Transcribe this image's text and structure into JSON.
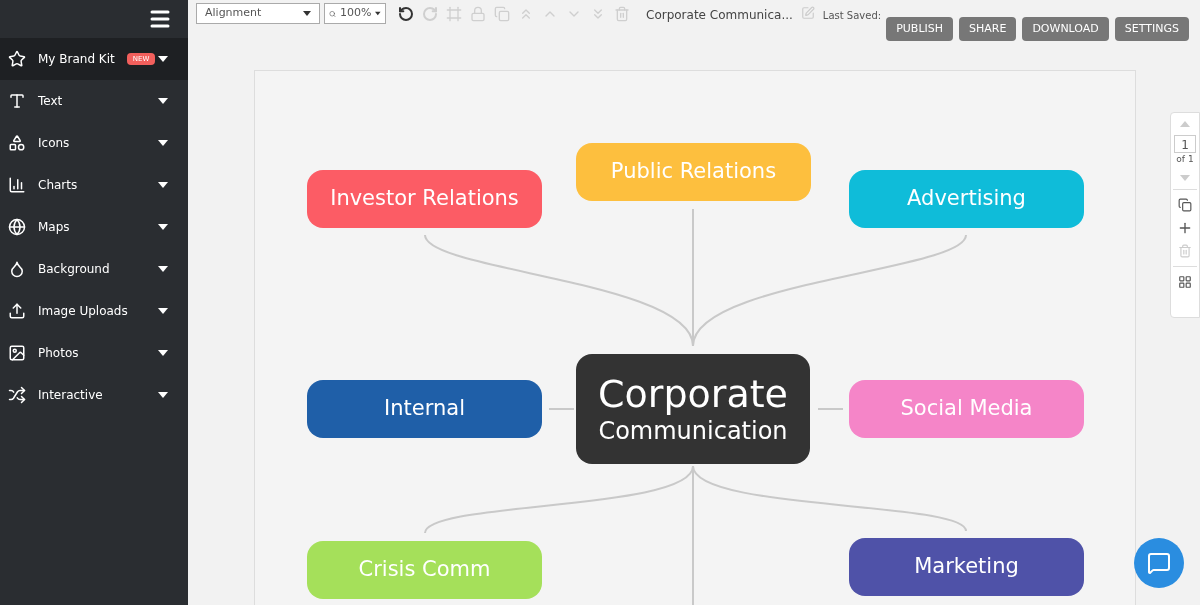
{
  "sidebar": {
    "items": [
      {
        "label": "My Brand Kit",
        "badge": "NEW",
        "selected": true
      },
      {
        "label": "Text",
        "selected": false
      },
      {
        "label": "Icons",
        "selected": false
      },
      {
        "label": "Charts",
        "selected": false
      },
      {
        "label": "Maps",
        "selected": false
      },
      {
        "label": "Background",
        "selected": false
      },
      {
        "label": "Image Uploads",
        "selected": false
      },
      {
        "label": "Photos",
        "selected": false
      },
      {
        "label": "Interactive",
        "selected": false
      }
    ]
  },
  "toolbar": {
    "alignment": "Alignment",
    "zoom": "100%",
    "title": "Corporate Communica...",
    "last_saved": "Last Saved:",
    "buttons": [
      "PUBLISH",
      "SHARE",
      "DOWNLOAD",
      "SETTINGS"
    ]
  },
  "page_nav": {
    "page": "1",
    "of": "of 1"
  },
  "mindmap": {
    "nodes": [
      {
        "kind": "topic",
        "label": "Investor Relations",
        "color": "#fc5c65"
      },
      {
        "kind": "topic",
        "label": "Public Relations",
        "color": "#fdbf3e"
      },
      {
        "kind": "topic",
        "label": "Advertising",
        "color": "#0fbcd9"
      },
      {
        "kind": "topic",
        "label": "Internal",
        "color": "#1f5fa8"
      },
      {
        "kind": "center",
        "label": "Corporate",
        "sublabel": "Communication",
        "color": "#333333"
      },
      {
        "kind": "topic",
        "label": "Social Media",
        "color": "#f585c8"
      },
      {
        "kind": "topic",
        "label": "Crisis Comm",
        "color": "#a5e05a"
      },
      {
        "kind": "topic",
        "label": "Marketing",
        "color": "#4f52a8"
      }
    ]
  }
}
